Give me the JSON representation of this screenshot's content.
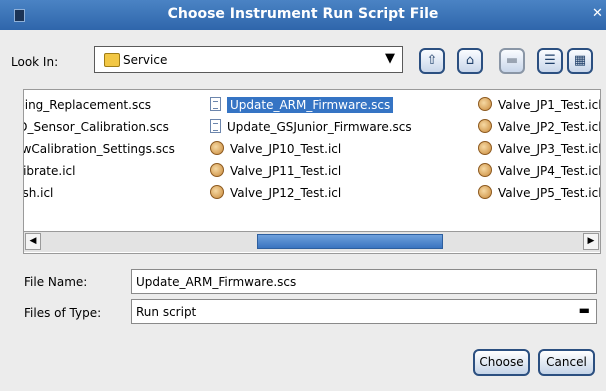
{
  "window": {
    "title": "Choose Instrument Run Script File"
  },
  "toolbar": {
    "look_in_label": "Look In:",
    "look_in_value": "Service"
  },
  "files": {
    "col1": [
      "Tubing_Replacement.scs",
      "LED_Sensor_Calibration.scs",
      "FlowCalibration_Settings.scs",
      "Calibrate.icl",
      "Wash.icl"
    ],
    "col2": [
      "Update_ARM_Firmware.scs",
      "Update_GSJunior_Firmware.scs",
      "Valve_JP10_Test.icl",
      "Valve_JP11_Test.icl",
      "Valve_JP12_Test.icl"
    ],
    "col3": [
      "Valve_JP1_Test.icl",
      "Valve_JP2_Test.icl",
      "Valve_JP3_Test.icl",
      "Valve_JP4_Test.icl",
      "Valve_JP5_Test.icl"
    ],
    "selected": "Update_ARM_Firmware.scs"
  },
  "form": {
    "file_name_label": "File Name:",
    "file_name_value": "Update_ARM_Firmware.scs",
    "file_type_label": "Files of Type:",
    "file_type_value": "Run script"
  },
  "buttons": {
    "choose": "Choose",
    "cancel": "Cancel"
  }
}
